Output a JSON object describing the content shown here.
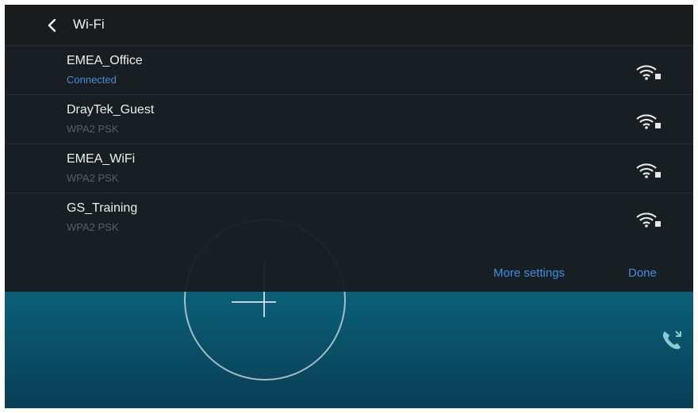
{
  "header": {
    "title": "Wi-Fi"
  },
  "networks": [
    {
      "name": "EMEA_Office",
      "status": "Connected"
    },
    {
      "name": "DrayTek_Guest",
      "status": "WPA2 PSK"
    },
    {
      "name": "EMEA_WiFi",
      "status": "WPA2 PSK"
    },
    {
      "name": "GS_Training",
      "status": "WPA2 PSK"
    }
  ],
  "footer": {
    "more_settings": "More settings",
    "done": "Done"
  },
  "icons": {
    "back": "chevron-left-icon",
    "wifi": "wifi-locked-icon",
    "call": "phone-transfer-icon"
  },
  "colors": {
    "accent": "#3f8ee0",
    "panel": "#1a1b1d"
  }
}
